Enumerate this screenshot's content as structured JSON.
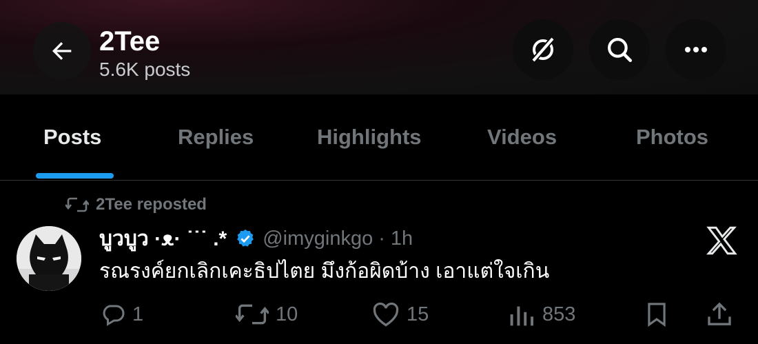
{
  "header": {
    "title": "2Tee",
    "subtitle": "5.6K posts",
    "icons": [
      "back-arrow-icon",
      "grok-icon",
      "search-icon",
      "more-icon"
    ]
  },
  "tabs": [
    {
      "label": "Posts",
      "active": true
    },
    {
      "label": "Replies",
      "active": false
    },
    {
      "label": "Highlights",
      "active": false
    },
    {
      "label": "Videos",
      "active": false
    },
    {
      "label": "Photos",
      "active": false
    }
  ],
  "post": {
    "repost_label": "2Tee reposted",
    "display_name": "บูวบูว ·ᴥ· ˙˙˙ .*",
    "handle": "@imyginkgo",
    "separator": "·",
    "time": "1h",
    "text": "รณรงค์ยกเลิกเคะธิปไตย มึงก้อผิดบ้าง เอาแต่ใจเกิน",
    "actions": {
      "replies": "1",
      "reposts": "10",
      "likes": "15",
      "views": "853"
    }
  },
  "colors": {
    "accent": "#1d9bf0",
    "muted": "#71767b",
    "background": "#000000"
  }
}
